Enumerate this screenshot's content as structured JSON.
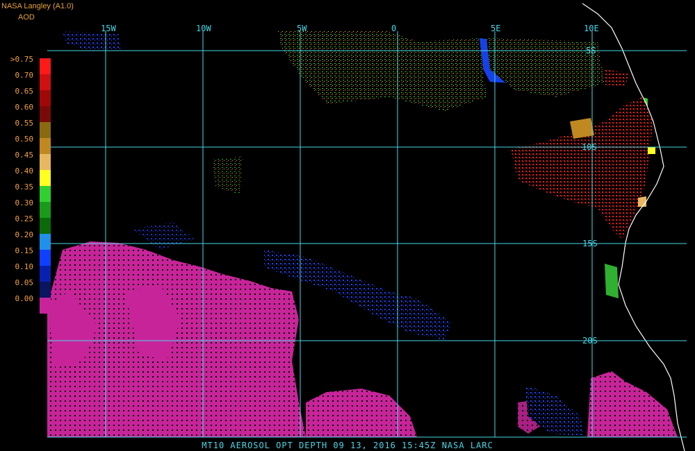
{
  "header": {
    "producer": "NASA Langley (A1.0)",
    "product": "AOD"
  },
  "legend": {
    "labels": [
      ">0.75",
      "0.70",
      "0.65",
      "0.60",
      "0.55",
      "0.50",
      "0.45",
      "0.40",
      "0.35",
      "0.30",
      "0.25",
      "0.20",
      "0.15",
      "0.10",
      "0.05",
      "0.00"
    ],
    "colors": [
      "#ff1a1a",
      "#d01010",
      "#a00808",
      "#7a0a0a",
      "#8a6a10",
      "#c08820",
      "#e8b860",
      "#ffff20",
      "#30d030",
      "#1a9a1a",
      "#0a6a0a",
      "#2090e8",
      "#1040ff",
      "#0820b0",
      "#0a1460",
      "#c8249a"
    ]
  },
  "grid": {
    "lon_labels": [
      "15W",
      "10W",
      "5W",
      "0",
      "5E",
      "10E"
    ],
    "lat_labels": [
      "5S",
      "10S",
      "15S",
      "20S"
    ]
  },
  "footer": {
    "text": "MT10  AEROSOL OPT DEPTH   09 13, 2016 15:45Z   NASA LARC"
  }
}
